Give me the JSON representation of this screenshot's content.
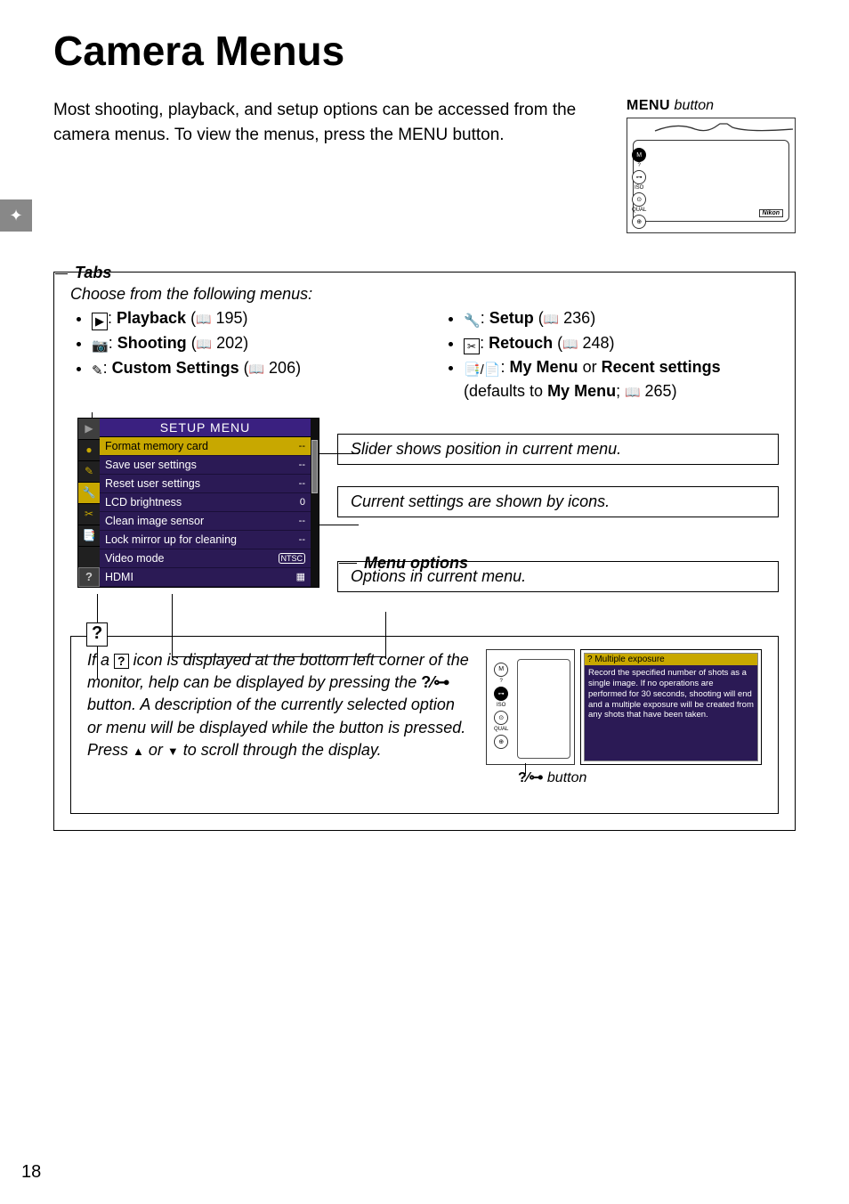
{
  "page_number": "18",
  "side_tab_icon": "✦",
  "title": "Camera Menus",
  "intro": "Most shooting, playback, and setup options can be accessed from the camera menus.  To view the menus, press the MENU button.",
  "menu_button_label_prefix": "MENU",
  "menu_button_label_suffix": " button",
  "tabs": {
    "heading": "Tabs",
    "choose_line": "Choose from the following menus:",
    "left": [
      {
        "icon": "▶",
        "boxed": true,
        "label": "Playback",
        "page": "195"
      },
      {
        "icon": "📷",
        "boxed": false,
        "label": "Shooting",
        "page": "202"
      },
      {
        "icon": "✎",
        "boxed": false,
        "label": "Custom Settings",
        "page": "206"
      }
    ],
    "right": [
      {
        "icon": "🔧",
        "label": "Setup",
        "page": "236",
        "simple": true
      },
      {
        "icon": "✂",
        "label": "Retouch",
        "page": "248",
        "boxed": true,
        "simple": true
      },
      {
        "icon": "📑/📄",
        "label_bold1": "My Menu",
        "mid": " or ",
        "label_bold2": "Recent settings",
        "suffix": " (defaults to ",
        "label_bold3": "My Menu",
        "tail": "; ",
        "page": "265",
        "simple": false
      }
    ]
  },
  "lcd": {
    "header": "SETUP MENU",
    "tabs": [
      "▶",
      "●",
      "✎",
      "🔧",
      "✂",
      "📑"
    ],
    "rows": [
      {
        "name": "Format memory card",
        "val": "--",
        "sel": true
      },
      {
        "name": "Save user settings",
        "val": "--"
      },
      {
        "name": "Reset user settings",
        "val": "--"
      },
      {
        "name": "LCD brightness",
        "val": "0"
      },
      {
        "name": "Clean image sensor",
        "val": "--"
      },
      {
        "name": "Lock mirror up for cleaning",
        "val": "--"
      },
      {
        "name": "Video mode",
        "val": "NTSC",
        "boxval": true
      },
      {
        "name": "HDMI",
        "val": "▦"
      }
    ],
    "q": "?"
  },
  "callouts": {
    "slider": "Slider shows position in current menu.",
    "icons": "Current settings are shown by icons.",
    "menu_options_title": "Menu options",
    "menu_options_text": "Options in current menu."
  },
  "help": {
    "icon": "?",
    "text_parts": {
      "p1": "If a ",
      "p2": " icon is displayed at the bottom left corner of the monitor, help can be displayed by pressing the ",
      "p3": " button.  A description of the currently selected option or menu will be displayed while the button is pressed.  Press ",
      "p4": " or ",
      "p5": " to scroll through the display."
    },
    "btn_glyph": "?⁄⊶",
    "screen_title": "? Multiple exposure",
    "screen_body": "Record the specified number of shots as a single image. If no operations are performed for 30 seconds, shooting will end and a multiple exposure will be created from any shots that have been taken.",
    "btn_label_suffix": " button"
  }
}
